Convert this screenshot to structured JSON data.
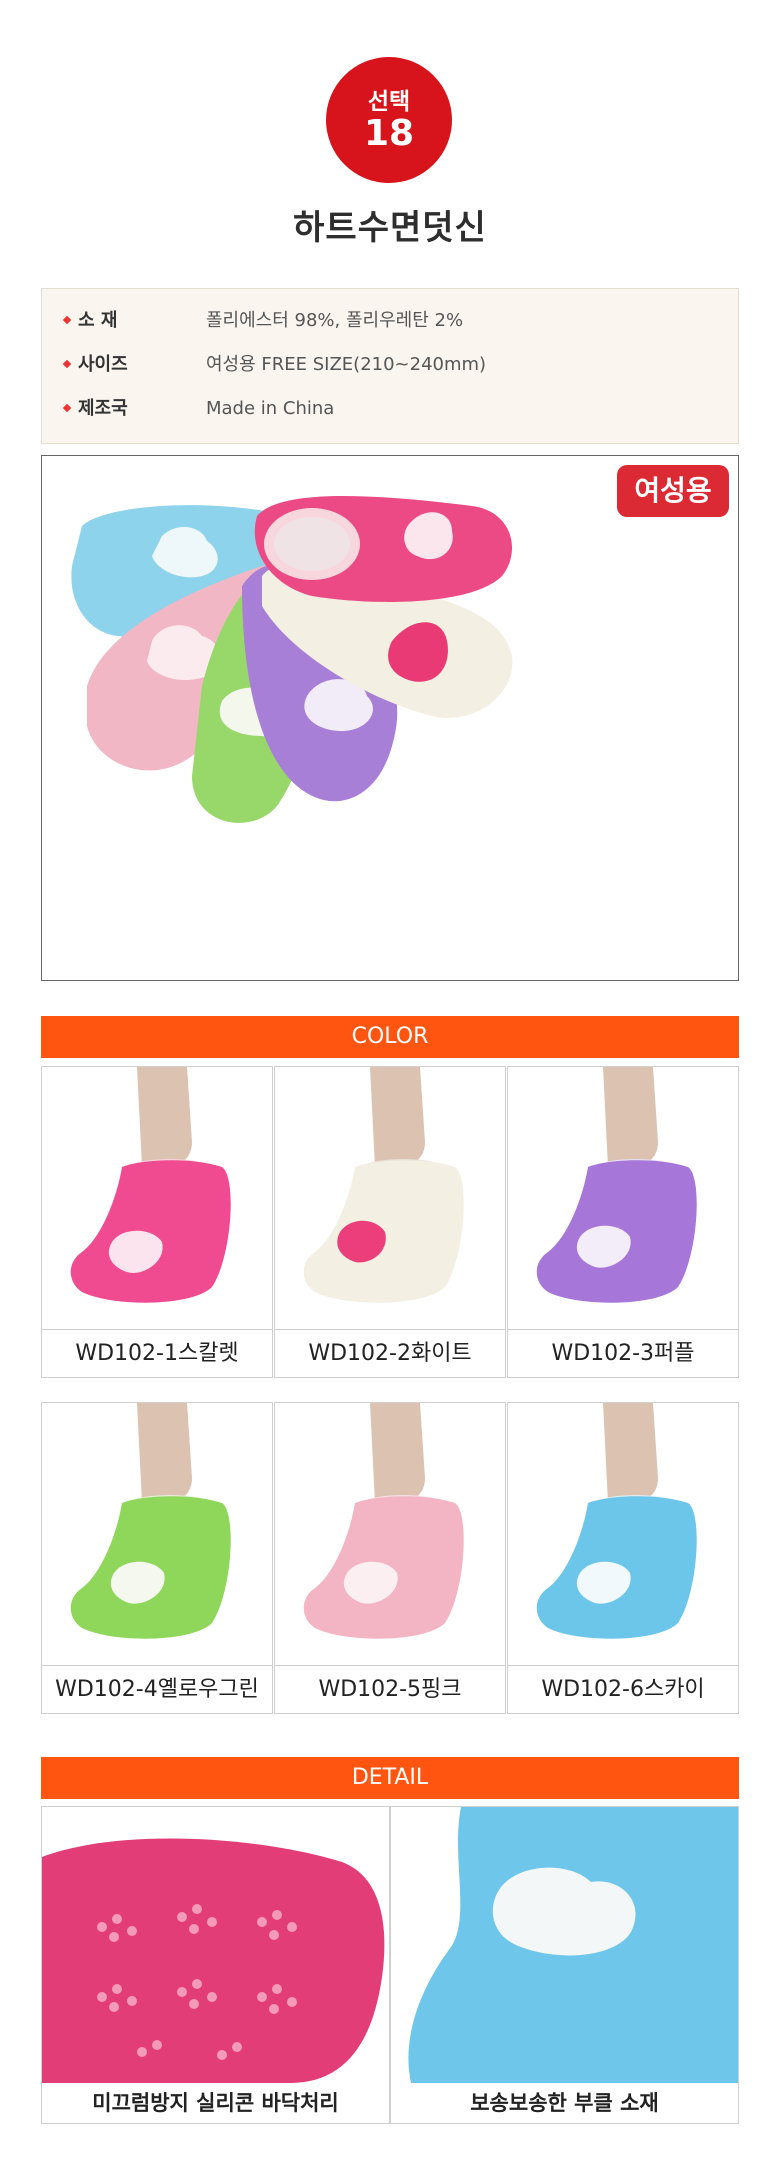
{
  "header": {
    "badge_label": "선택",
    "badge_number": "18",
    "title": "하트수면덧신"
  },
  "spec": [
    {
      "key": "소   재",
      "value": "폴리에스터 98%, 폴리우레탄 2%"
    },
    {
      "key": "사이즈",
      "value": "여성용 FREE SIZE(210~240mm)"
    },
    {
      "key": "제조국",
      "value": "Made in China"
    }
  ],
  "main_photo": {
    "tag": "여성용"
  },
  "colors": {
    "section_title": "COLOR",
    "items": [
      {
        "label": "WD102-1스칼렛",
        "sock_color": "#f04b91",
        "heart_color": "#fbe4ee"
      },
      {
        "label": "WD102-2화이트",
        "sock_color": "#f3efe2",
        "heart_color": "#ec3e7a"
      },
      {
        "label": "WD102-3퍼플",
        "sock_color": "#a676d8",
        "heart_color": "#f3ecf9"
      },
      {
        "label": "WD102-4옐로우그린",
        "sock_color": "#8ed75a",
        "heart_color": "#f5f8ee"
      },
      {
        "label": "WD102-5핑크",
        "sock_color": "#f3b5c3",
        "heart_color": "#fbeff2"
      },
      {
        "label": "WD102-6스카이",
        "sock_color": "#6cc6ea",
        "heart_color": "#f2f9fc"
      }
    ]
  },
  "detail": {
    "section_title": "DETAIL",
    "items": [
      {
        "label": "미끄럼방지 실리콘 바닥처리"
      },
      {
        "label": "보송보송한 부클 소재"
      }
    ]
  },
  "accent_color": "#ff5510",
  "badge_color": "#d7141b"
}
